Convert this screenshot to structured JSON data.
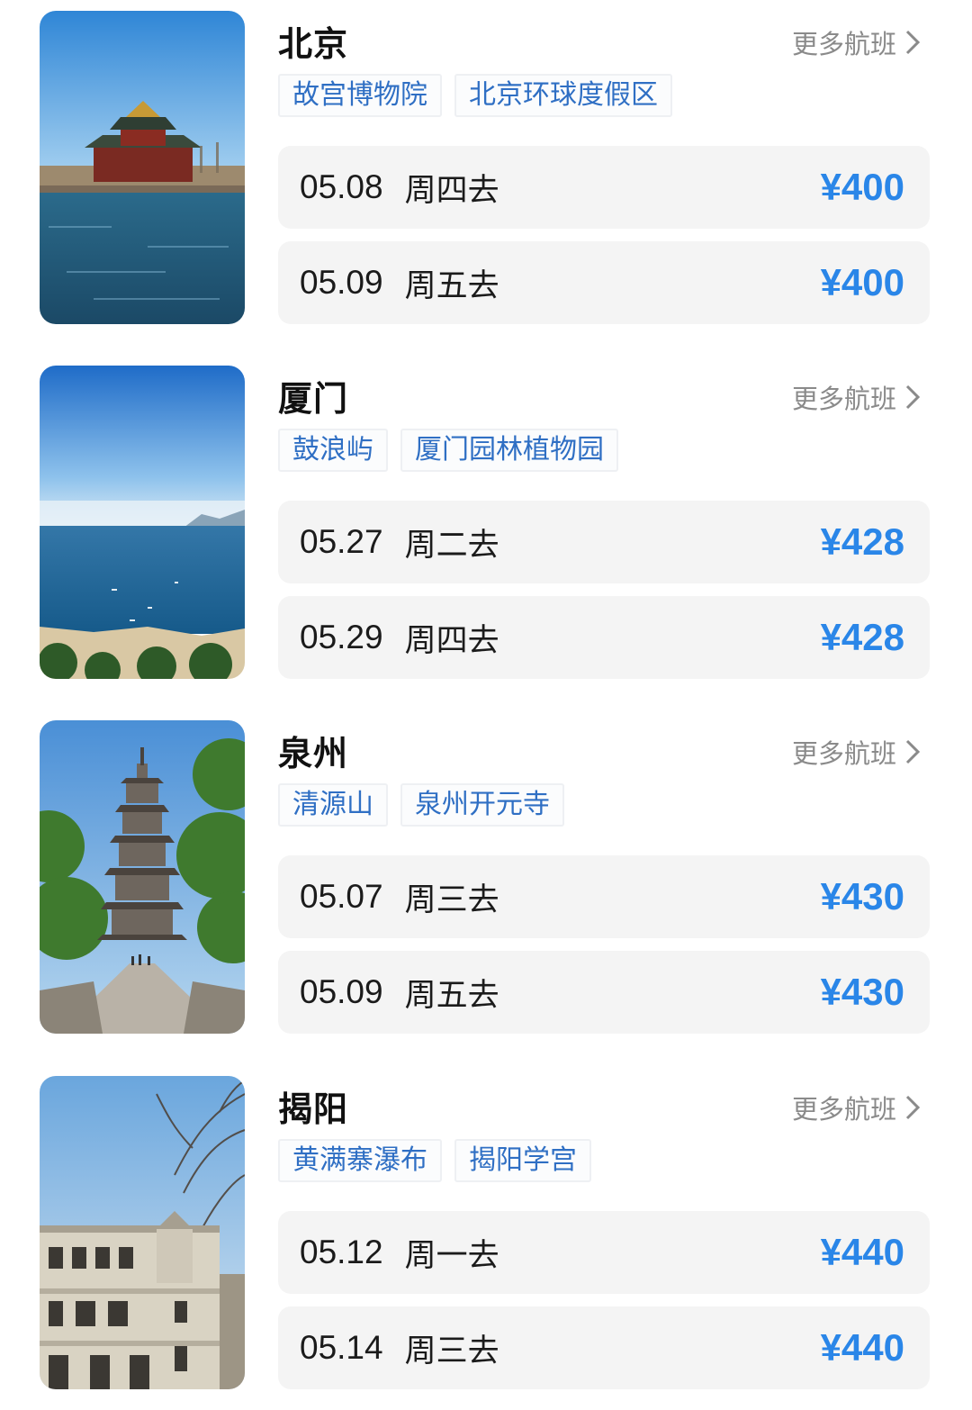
{
  "destinations": [
    {
      "city": "北京",
      "more_label": "更多航班",
      "tags": [
        "故宫博物院",
        "北京环球度假区"
      ],
      "flights": [
        {
          "date": "05.08",
          "day": "周四去",
          "price": "¥400"
        },
        {
          "date": "05.09",
          "day": "周五去",
          "price": "¥400"
        }
      ]
    },
    {
      "city": "厦门",
      "more_label": "更多航班",
      "tags": [
        "鼓浪屿",
        "厦门园林植物园"
      ],
      "flights": [
        {
          "date": "05.27",
          "day": "周二去",
          "price": "¥428"
        },
        {
          "date": "05.29",
          "day": "周四去",
          "price": "¥428"
        }
      ]
    },
    {
      "city": "泉州",
      "more_label": "更多航班",
      "tags": [
        "清源山",
        "泉州开元寺"
      ],
      "flights": [
        {
          "date": "05.07",
          "day": "周三去",
          "price": "¥430"
        },
        {
          "date": "05.09",
          "day": "周五去",
          "price": "¥430"
        }
      ]
    },
    {
      "city": "揭阳",
      "more_label": "更多航班",
      "tags": [
        "黄满寨瀑布",
        "揭阳学宫"
      ],
      "flights": [
        {
          "date": "05.12",
          "day": "周一去",
          "price": "¥440"
        },
        {
          "date": "05.14",
          "day": "周三去",
          "price": "¥440"
        }
      ]
    }
  ],
  "colors": {
    "price": "#2a86e8",
    "tag_text": "#2f6fc4",
    "more_text": "#8a8a8a",
    "row_bg": "#f4f4f4"
  },
  "icons": {
    "more": "chevron-right-icon"
  }
}
